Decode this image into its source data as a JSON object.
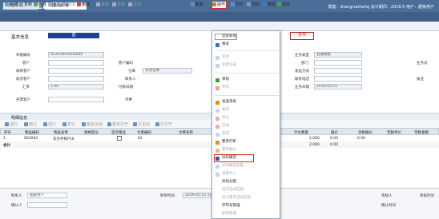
{
  "app": {
    "logo": "Aisino ERP.A6",
    "user_info": "账套：shangruizhong 会计期间：2018.5 用户：超级用户"
  },
  "tabs": [
    {
      "label": "功能导航"
    },
    {
      "label": "销售出库单"
    }
  ],
  "toolbar": {
    "items": [
      {
        "label": "新增",
        "enabled": true
      },
      {
        "label": "复制",
        "enabled": true
      },
      {
        "label": "修改",
        "enabled": true
      },
      {
        "label": "保存",
        "enabled": false
      },
      {
        "label": "取消",
        "enabled": false
      },
      {
        "label": "删除",
        "enabled": true
      },
      {
        "label": "审核",
        "enabled": false
      },
      {
        "label": "弃审",
        "enabled": false
      },
      {
        "label": "关闭",
        "enabled": false
      },
      {
        "label": "联查",
        "enabled": true
      },
      {
        "label": "操作",
        "enabled": true
      },
      {
        "label": "打印",
        "enabled": true
      },
      {
        "label": "附件",
        "enabled": true
      },
      {
        "label": "帮助",
        "enabled": true
      },
      {
        "label": "退出",
        "enabled": true
      }
    ]
  },
  "header": {
    "section_label": "基本信息",
    "status_blue": "蓝",
    "status_stamp": "暂存",
    "fields": {
      "doc_no_label": "单据编号",
      "doc_no": "XC201905000000",
      "warehouse_label": "仓库",
      "warehouse": "华为仓库",
      "customer_label": "客户",
      "cust_code_label": "客户编码",
      "settle_customer_label": "收款客户",
      "receive_customer_label": "收货客户",
      "biz_date_label": "业务日期",
      "biz_date": "2019-05-15",
      "dept_label": "部门",
      "salesman_label": "业务员",
      "currency_label": "币种",
      "currency": "人民币",
      "rate_label": "汇率",
      "rate": "1.00",
      "ship_addr_label": "发运方式",
      "contact_label": "联系人",
      "contact_phone_label": "联系电话",
      "pay_date_label": "付款日期",
      "pay_date": "2019-05-15",
      "invoice_label": "开票客户",
      "biz_type_label": "业务类型",
      "biz_type": "普通销售",
      "remark_label": "备注"
    }
  },
  "detail": {
    "title": "明细信息",
    "toolbar": [
      "插行",
      "删行",
      "插行",
      "复行",
      "整单关闭",
      "整单打开",
      "行关闭",
      "行打开"
    ],
    "columns": [
      "序号",
      "物品编码",
      "物品名称",
      "规格型号",
      "是否赠品",
      "仓库编码",
      "仓库名称",
      "计价数量",
      "报价",
      "含税报价",
      "无税单价",
      "无税金额"
    ],
    "rows": [
      {
        "no": "1",
        "code": "001002",
        "name": "华为手机P10",
        "warehouse_code": "02",
        "qty": "2.000",
        "price": "0.00",
        "tax_price": "0.00"
      },
      {
        "no": "合计",
        "code": "",
        "name": "",
        "warehouse_code": "",
        "qty": "2.000",
        "price": "0.00",
        "tax_price": ""
      }
    ]
  },
  "footer": {
    "maker_label": "制单人",
    "maker": "超级用户",
    "make_time_label": "制单时间",
    "make_time": "2019-05-15 10:28:36",
    "auditor_label": "审核人",
    "audit_time_label": "审核时间",
    "confirm_label": "确认人",
    "confirm_time_label": "确认时间"
  },
  "menu": {
    "items": [
      {
        "label": "连续新增",
        "enabled": true
      },
      {
        "label": "格式",
        "enabled": true
      },
      {
        "label": "变更",
        "enabled": false
      },
      {
        "label": "变更记录",
        "enabled": false
      },
      {
        "label": "审核",
        "enabled": true
      },
      {
        "label": "弃审",
        "enabled": false
      },
      {
        "label": "发送消息",
        "enabled": true
      },
      {
        "label": "备档",
        "enabled": false
      },
      {
        "label": "终止",
        "enabled": false
      },
      {
        "label": "启动",
        "enabled": false
      },
      {
        "label": "完成",
        "enabled": false
      },
      {
        "label": "整单打折",
        "enabled": true
      },
      {
        "label": "整单报价",
        "enabled": false
      },
      {
        "label": "扫码输货",
        "enabled": true
      },
      {
        "label": "扫码输货配置",
        "enabled": false
      },
      {
        "label": "批量导入",
        "enabled": false
      },
      {
        "label": "拆组分配",
        "enabled": true
      },
      {
        "label": "批次自动匹配",
        "enabled": false
      },
      {
        "label": "批次重单自动匹配",
        "enabled": false
      },
      {
        "label": "序列号管理",
        "enabled": true
      },
      {
        "label": "复制管理",
        "enabled": false
      }
    ]
  }
}
